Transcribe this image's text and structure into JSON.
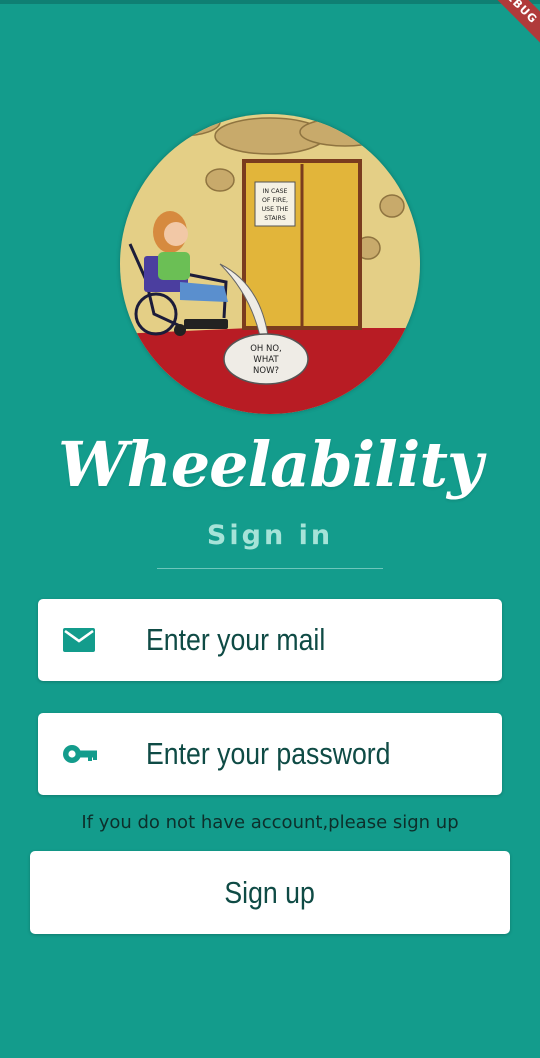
{
  "app": {
    "logo_text": "Wheelability",
    "subtitle": "Sign in",
    "debug_banner": "DEBUG"
  },
  "illustration": {
    "sign_text": [
      "IN CASE",
      "OF FIRE,",
      "USE THE",
      "STAIRS"
    ],
    "bubble_text": [
      "OH NO,",
      "WHAT",
      "NOW?"
    ]
  },
  "form": {
    "email": {
      "placeholder": "Enter your mail",
      "icon": "mail-icon"
    },
    "password": {
      "placeholder": "Enter your password",
      "icon": "key-icon"
    }
  },
  "hint": "If you do not have account,please sign up",
  "signup_label": "Sign up",
  "colors": {
    "background": "#139c8c",
    "field_text": "#0f4b45",
    "subtitle": "#a6e3d8"
  }
}
